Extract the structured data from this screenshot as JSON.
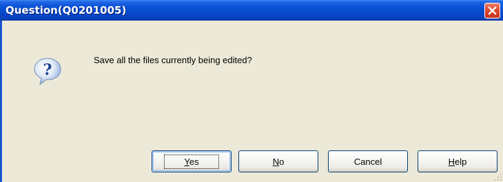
{
  "window": {
    "title": "Question(Q0201005)"
  },
  "dialog": {
    "message": "Save all the files currently being edited?",
    "icon": "question-icon"
  },
  "buttons": {
    "yes": {
      "mnemonic": "Y",
      "rest": "es"
    },
    "no": {
      "mnemonic": "N",
      "rest": "o"
    },
    "cancel": {
      "label": "Cancel"
    },
    "help": {
      "mnemonic": "H",
      "rest": "elp"
    }
  },
  "colors": {
    "titlebar": "#0a52d6",
    "close_button": "#e2523a",
    "dialog_background": "#ece9d8",
    "button_border": "#003c74"
  }
}
